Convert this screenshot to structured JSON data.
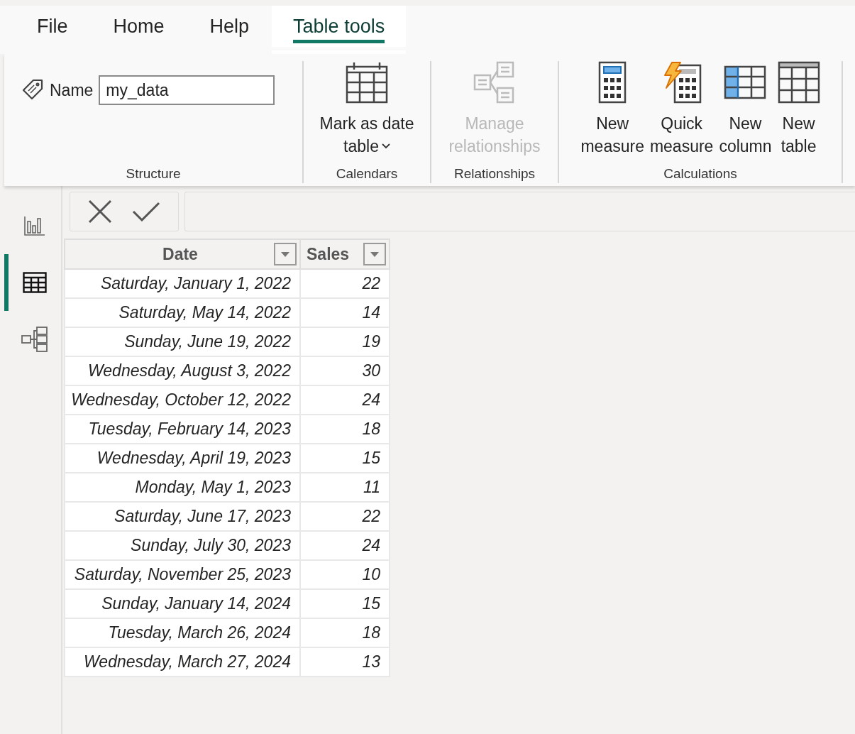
{
  "tabs": [
    {
      "label": "File",
      "selected": false
    },
    {
      "label": "Home",
      "selected": false
    },
    {
      "label": "Help",
      "selected": false
    },
    {
      "label": "Table tools",
      "selected": true
    }
  ],
  "ribbon_groups": [
    {
      "kind": "name",
      "label": "Structure",
      "field_label": "Name",
      "value": "my_data"
    },
    {
      "kind": "buttons",
      "label": "Calendars",
      "buttons": [
        {
          "kind": "calendar",
          "lines": [
            "Mark as date",
            "table"
          ],
          "dropdown": true,
          "disabled": false
        }
      ]
    },
    {
      "kind": "buttons",
      "label": "Relationships",
      "buttons": [
        {
          "kind": "relationships",
          "lines": [
            "Manage",
            "relationships"
          ],
          "dropdown": false,
          "disabled": true
        }
      ]
    },
    {
      "kind": "buttons",
      "label": "Calculations",
      "buttons": [
        {
          "kind": "measure",
          "lines": [
            "New",
            "measure"
          ],
          "dropdown": false,
          "disabled": false
        },
        {
          "kind": "quick",
          "lines": [
            "Quick",
            "measure"
          ],
          "dropdown": false,
          "disabled": false
        },
        {
          "kind": "column",
          "lines": [
            "New",
            "column"
          ],
          "dropdown": false,
          "disabled": false
        },
        {
          "kind": "table",
          "lines": [
            "New",
            "table"
          ],
          "dropdown": false,
          "disabled": false
        }
      ]
    }
  ],
  "side_rail": [
    {
      "kind": "report",
      "selected": false
    },
    {
      "kind": "data",
      "selected": true
    },
    {
      "kind": "model",
      "selected": false
    }
  ],
  "table": {
    "columns": [
      "Date",
      "Sales"
    ],
    "rows": [
      [
        "Saturday, January 1, 2022",
        "22"
      ],
      [
        "Saturday, May 14, 2022",
        "14"
      ],
      [
        "Sunday, June 19, 2022",
        "19"
      ],
      [
        "Wednesday, August 3, 2022",
        "30"
      ],
      [
        "Wednesday, October 12, 2022",
        "24"
      ],
      [
        "Tuesday, February 14, 2023",
        "18"
      ],
      [
        "Wednesday, April 19, 2023",
        "15"
      ],
      [
        "Monday, May 1, 2023",
        "11"
      ],
      [
        "Saturday, June 17, 2023",
        "22"
      ],
      [
        "Sunday, July 30, 2023",
        "24"
      ],
      [
        "Saturday, November 25, 2023",
        "10"
      ],
      [
        "Sunday, January 14, 2024",
        "15"
      ],
      [
        "Tuesday, March 26, 2024",
        "18"
      ],
      [
        "Wednesday, March 27, 2024",
        "13"
      ]
    ]
  }
}
